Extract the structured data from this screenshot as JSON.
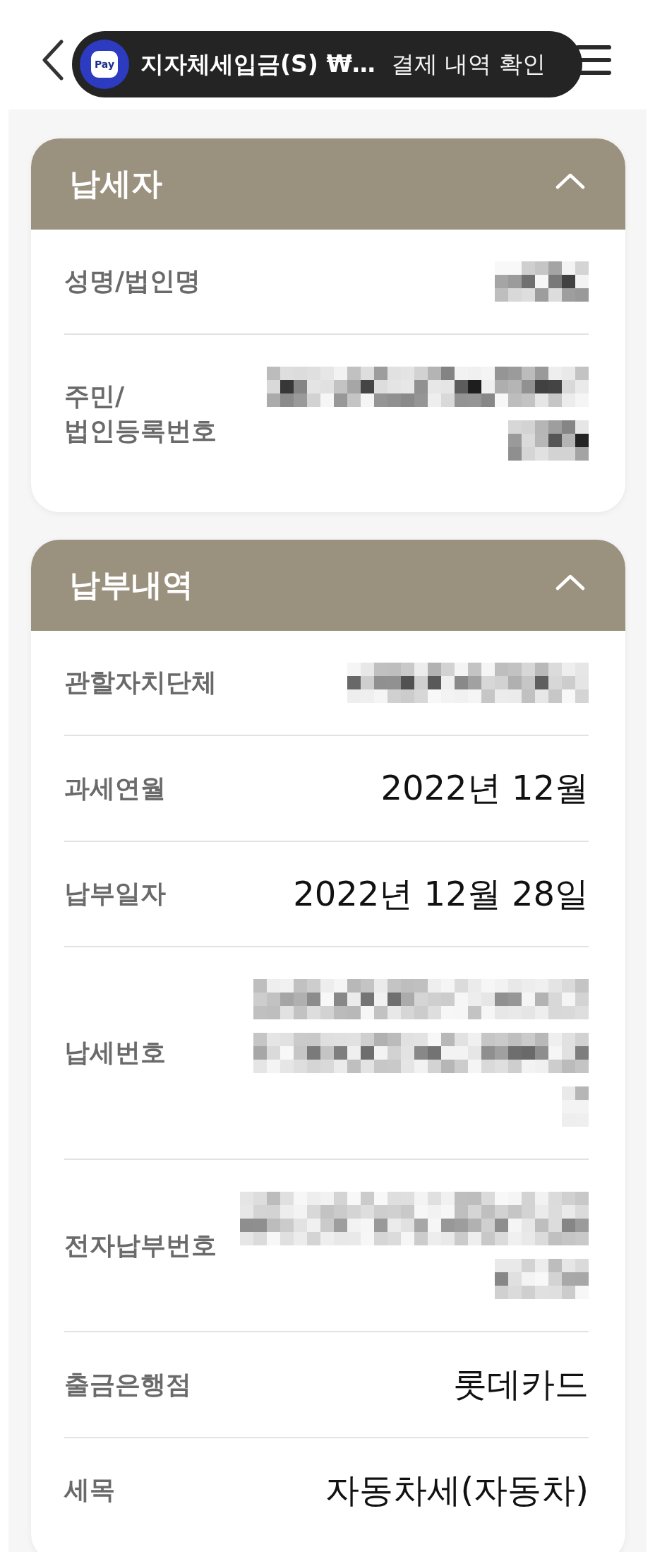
{
  "notification": {
    "app_label": "Pay",
    "title": "지자체세입금(S) ₩…",
    "message": "결제 내역 확인"
  },
  "sections": [
    {
      "title": "납세자",
      "expanded": true,
      "rows": [
        {
          "label": "성명/법인명",
          "kind": "redacted"
        },
        {
          "label": "주민/법인등록번호",
          "kind": "redacted"
        }
      ]
    },
    {
      "title": "납부내역",
      "expanded": true,
      "rows": [
        {
          "label": "관할자치단체",
          "kind": "redacted"
        },
        {
          "label": "과세연월",
          "kind": "text",
          "value": "2022년 12월"
        },
        {
          "label": "납부일자",
          "kind": "text",
          "value": "2022년 12월 28일"
        },
        {
          "label": "납세번호",
          "kind": "redacted"
        },
        {
          "label": "전자납부번호",
          "kind": "redacted"
        },
        {
          "label": "출금은행점",
          "kind": "text",
          "value": "롯데카드"
        },
        {
          "label": "세목",
          "kind": "text",
          "value": "자동차세(자동차)"
        }
      ]
    }
  ]
}
